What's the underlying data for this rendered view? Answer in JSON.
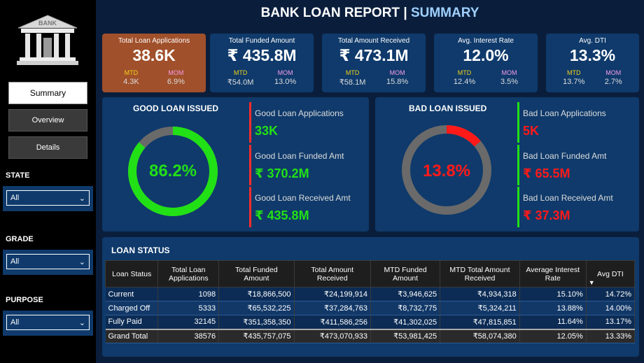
{
  "header": {
    "title_main": "BANK LOAN REPORT",
    "separator": "|",
    "title_accent": "SUMMARY"
  },
  "sidebar": {
    "logo_text": "BANK",
    "nav": {
      "summary": "Summary",
      "overview": "Overview",
      "details": "Details"
    },
    "filters": [
      {
        "label": "STATE",
        "value": "All"
      },
      {
        "label": "GRADE",
        "value": "All"
      },
      {
        "label": "PURPOSE",
        "value": "All"
      }
    ]
  },
  "kpis": [
    {
      "label": "Total Loan Applications",
      "value": "38.6K",
      "mtd_label": "MTD",
      "mtd": "4.3K",
      "mom_label": "MOM",
      "mom": "6.9%"
    },
    {
      "label": "Total  Funded Amount",
      "value": "₹ 435.8M",
      "mtd_label": "MTD",
      "mtd": "₹54.0M",
      "mom_label": "MOM",
      "mom": "13.0%"
    },
    {
      "label": "Total Amount Received",
      "value": "₹ 473.1M",
      "mtd_label": "MTD",
      "mtd": "₹58.1M",
      "mom_label": "MOM",
      "mom": "15.8%"
    },
    {
      "label": "Avg. Interest Rate",
      "value": "12.0%",
      "mtd_label": "MTD",
      "mtd": "12.4%",
      "mom_label": "MOM",
      "mom": "3.5%"
    },
    {
      "label": "Avg. DTI",
      "value": "13.3%",
      "mtd_label": "MTD",
      "mtd": "13.7%",
      "mom_label": "MOM",
      "mom": "2.7%"
    }
  ],
  "good_loan": {
    "title": "GOOD LOAN ISSUED",
    "percent_label": "86.2%",
    "percent": 0.862,
    "color": "#22e016",
    "stats": [
      {
        "label": "Good Loan Applications",
        "value": "33K"
      },
      {
        "label": "Good Loan Funded Amt",
        "value": "₹ 370.2M"
      },
      {
        "label": "Good Loan Received Amt",
        "value": "₹ 435.8M"
      }
    ]
  },
  "bad_loan": {
    "title": "BAD LOAN ISSUED",
    "percent_label": "13.8%",
    "percent": 0.138,
    "color": "#ff1a1a",
    "stats": [
      {
        "label": "Bad Loan Applications",
        "value": "5K"
      },
      {
        "label": "Bad Loan Funded Amt",
        "value": "₹ 65.5M"
      },
      {
        "label": "Bad Loan Received Amt",
        "value": "₹ 37.3M"
      }
    ]
  },
  "loan_status": {
    "title": "LOAN STATUS",
    "headers": [
      "Loan Status",
      "Total Loan Applications",
      "Total Funded Amount",
      "Total Amount Received",
      "MTD Funded Amount",
      "MTD Total Amount Received",
      "Average Interest Rate",
      "Avg DTI"
    ],
    "rows": [
      [
        "Current",
        "1098",
        "₹18,866,500",
        "₹24,199,914",
        "₹3,946,625",
        "₹4,934,318",
        "15.10%",
        "14.72%"
      ],
      [
        "Charged Off",
        "5333",
        "₹65,532,225",
        "₹37,284,763",
        "₹8,732,775",
        "₹5,324,211",
        "13.88%",
        "14.00%"
      ],
      [
        "Fully Paid",
        "32145",
        "₹351,358,350",
        "₹411,586,256",
        "₹41,302,025",
        "₹47,815,851",
        "11.64%",
        "13.17%"
      ]
    ],
    "total": [
      "Grand Total",
      "38576",
      "₹435,757,075",
      "₹473,070,933",
      "₹53,981,425",
      "₹58,074,380",
      "12.05%",
      "13.33%"
    ]
  }
}
